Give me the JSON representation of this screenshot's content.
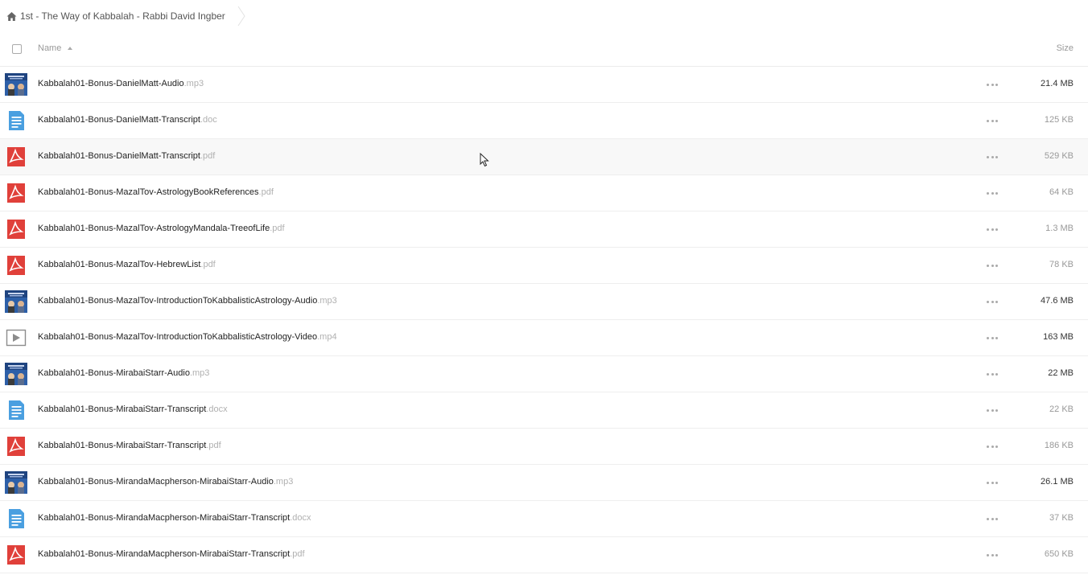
{
  "breadcrumb": {
    "label": "1st - The Way of Kabbalah - Rabbi David Ingber"
  },
  "columns": {
    "name": "Name",
    "size": "Size"
  },
  "colors": {
    "pdf_red": "#e0403a",
    "doc_blue": "#4a9fe0",
    "video_gray": "#8c8c8c",
    "audio_blue": "#2d5fa8"
  },
  "files": [
    {
      "name": "Kabbalah01-Bonus-DanielMatt-Audio",
      "ext": ".mp3",
      "size": "21.4 MB",
      "icon": "audio-thumbnail-icon"
    },
    {
      "name": "Kabbalah01-Bonus-DanielMatt-Transcript",
      "ext": ".doc",
      "size": "125 KB",
      "icon": "document-icon"
    },
    {
      "name": "Kabbalah01-Bonus-DanielMatt-Transcript",
      "ext": ".pdf",
      "size": "529 KB",
      "icon": "pdf-icon"
    },
    {
      "name": "Kabbalah01-Bonus-MazalTov-AstrologyBookReferences",
      "ext": ".pdf",
      "size": "64 KB",
      "icon": "pdf-icon"
    },
    {
      "name": "Kabbalah01-Bonus-MazalTov-AstrologyMandala-TreeofLife",
      "ext": ".pdf",
      "size": "1.3 MB",
      "icon": "pdf-icon"
    },
    {
      "name": "Kabbalah01-Bonus-MazalTov-HebrewList",
      "ext": ".pdf",
      "size": "78 KB",
      "icon": "pdf-icon"
    },
    {
      "name": "Kabbalah01-Bonus-MazalTov-IntroductionToKabbalisticAstrology-Audio",
      "ext": ".mp3",
      "size": "47.6 MB",
      "icon": "audio-thumbnail-icon"
    },
    {
      "name": "Kabbalah01-Bonus-MazalTov-IntroductionToKabbalisticAstrology-Video",
      "ext": ".mp4",
      "size": "163 MB",
      "icon": "video-icon"
    },
    {
      "name": "Kabbalah01-Bonus-MirabaiStarr-Audio",
      "ext": ".mp3",
      "size": "22 MB",
      "icon": "audio-thumbnail-icon"
    },
    {
      "name": "Kabbalah01-Bonus-MirabaiStarr-Transcript",
      "ext": ".docx",
      "size": "22 KB",
      "icon": "document-icon"
    },
    {
      "name": "Kabbalah01-Bonus-MirabaiStarr-Transcript",
      "ext": ".pdf",
      "size": "186 KB",
      "icon": "pdf-icon"
    },
    {
      "name": "Kabbalah01-Bonus-MirandaMacpherson-MirabaiStarr-Audio",
      "ext": ".mp3",
      "size": "26.1 MB",
      "icon": "audio-thumbnail-icon"
    },
    {
      "name": "Kabbalah01-Bonus-MirandaMacpherson-MirabaiStarr-Transcript",
      "ext": ".docx",
      "size": "37 KB",
      "icon": "document-icon"
    },
    {
      "name": "Kabbalah01-Bonus-MirandaMacpherson-MirabaiStarr-Transcript",
      "ext": ".pdf",
      "size": "650 KB",
      "icon": "pdf-icon"
    }
  ]
}
